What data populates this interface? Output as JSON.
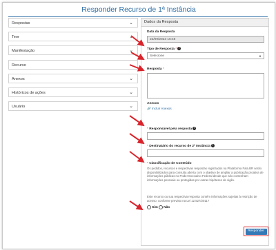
{
  "page": {
    "title": "Responder Recurso de 1ª Instância"
  },
  "accordion": [
    {
      "label": "Respostas"
    },
    {
      "label": "Teor"
    },
    {
      "label": "Manifestação"
    },
    {
      "label": "Recurso"
    },
    {
      "label": "Anexos"
    },
    {
      "label": "Históricos de ações"
    },
    {
      "label": "Usuário"
    }
  ],
  "form": {
    "header": "Dados da Resposta",
    "data_resposta_label": "Data da Resposta",
    "data_resposta_value": "22/09/2023 16:48",
    "tipo_label": "Tipo de Resposta",
    "tipo_placeholder": "Selecione",
    "resposta_label": "Resposta",
    "anexos_label": "Anexos",
    "anexos_link": "Incluir Anexos",
    "responsavel_label": "Responsável pela resposta",
    "destinatario_label": "Destinatário do recurso de 2ª Instância",
    "classificacao_label": "Classificação de Conteúdo",
    "classificacao_text": "Os pedidos, recursos e respectivas respostas registrados na Plataforma Fala.BR serão disponibilizados para consulta aberta com o objetivo de ampliar a publicação proativa de informações públicas no Poder Executivo Federal desde que não contenham informações pessoais ou protegidas por outras hipóteses de sigilo.",
    "question_text": "Este recurso ou sua respectiva resposta contém informações sujeitas à restrição de acesso, conforme previsto na Lei 12.527/2011?",
    "radio_sim": "Sim",
    "radio_nao": "Não",
    "required_mark": "*",
    "help_glyph": "?",
    "submit_label": "Responder"
  },
  "colors": {
    "title": "#2e6da4",
    "button": "#337ab7",
    "arrow": "#d9242b"
  }
}
